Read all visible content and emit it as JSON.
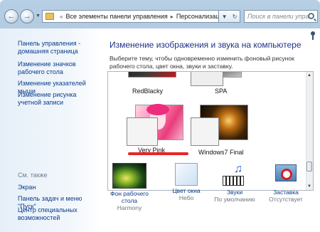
{
  "navigation": {
    "address_parts": [
      "Все элементы панели управления",
      "Персонализация"
    ],
    "search_placeholder": "Поиск в панели управления"
  },
  "sidebar": {
    "home_link": "Панель управления - домашняя страница",
    "links": [
      "Изменение значков рабочего стола",
      "Изменение указателей мыши",
      "Изменение рисунка учетной записи"
    ],
    "see_also_title": "См. также",
    "see_also": [
      "Экран",
      "Панель задач и меню \"Пуск\"",
      "Центр специальных возможностей"
    ]
  },
  "main": {
    "title": "Изменение изображения и звука на компьютере",
    "description": "Выберите тему, чтобы одновременно изменить фоновый рисунок рабочего стола, цвет окна, звуки и заставку.",
    "themes": [
      {
        "name": "RedBlacky"
      },
      {
        "name": "SPA"
      },
      {
        "name": "Very Pink",
        "selected": true
      },
      {
        "name": "Windows7 Final"
      }
    ]
  },
  "bottom": [
    {
      "label": "Фон рабочего стола",
      "value": "Harmony",
      "icon": "desktop-background-icon"
    },
    {
      "label": "Цвет окна",
      "value": "Небо",
      "icon": "window-color-icon"
    },
    {
      "label": "Звуки",
      "value": "По умолчанию",
      "icon": "sounds-icon"
    },
    {
      "label": "Заставка",
      "value": "Отсутствует",
      "icon": "screensaver-icon"
    }
  ],
  "colors": {
    "link": "#0b3d8a",
    "title": "#1e3287",
    "selection": "#e5262a"
  }
}
